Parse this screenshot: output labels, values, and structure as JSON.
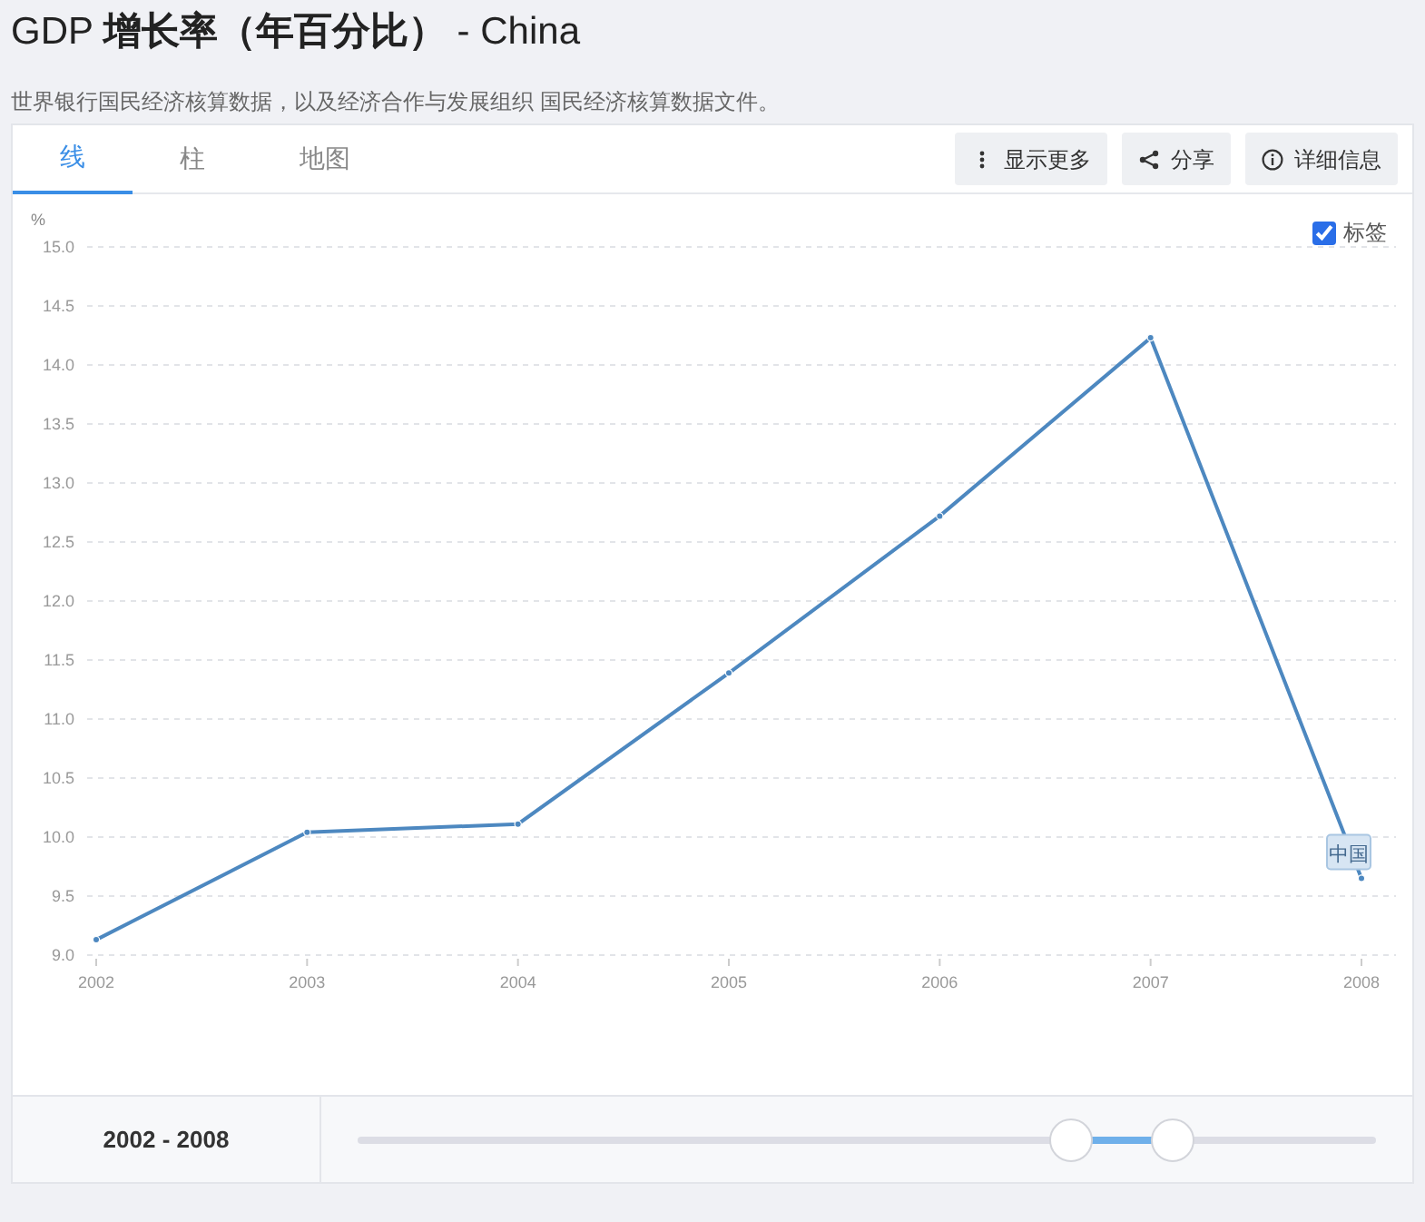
{
  "title": "GDP **增长率（年百分比）** - China",
  "subtitle": "世界银行国民经济核算数据，以及经济合作与发展组织 国民经济核算数据文件。",
  "tabs": [
    {
      "label": "线",
      "selected": true
    },
    {
      "label": "柱",
      "selected": false
    },
    {
      "label": "地图",
      "selected": false
    }
  ],
  "actions": [
    {
      "kind": "more",
      "label": "显示更多"
    },
    {
      "kind": "share",
      "label": "分享"
    },
    {
      "kind": "info",
      "label": "详细信息"
    }
  ],
  "labels_toggle": {
    "label": "标签",
    "checked": true
  },
  "chart_data": {
    "type": "line",
    "grid": true,
    "marker": true,
    "ylabel": "%",
    "categories": [
      "2002",
      "2003",
      "2004",
      "2005",
      "2006",
      "2007",
      "2008"
    ],
    "series": [
      {
        "name": "中国",
        "color": "#4d88c0",
        "values": [
          9.13,
          10.04,
          10.11,
          11.39,
          12.72,
          14.23,
          9.65
        ]
      }
    ],
    "ylim": [
      9.0,
      15.0
    ],
    "yticks": [
      {
        "value": 9.0,
        "label": "9.0"
      },
      {
        "value": 9.5,
        "label": "9.5"
      },
      {
        "value": 10.0,
        "label": "10.0"
      },
      {
        "value": 10.5,
        "label": "10.5"
      },
      {
        "value": 11.0,
        "label": "11.0"
      },
      {
        "value": 11.5,
        "label": "11.5"
      },
      {
        "value": 12.0,
        "label": "12.0"
      },
      {
        "value": 12.5,
        "label": "12.5"
      },
      {
        "value": 13.0,
        "label": "13.0"
      },
      {
        "value": 13.5,
        "label": "13.5"
      },
      {
        "value": 14.0,
        "label": "14.0"
      },
      {
        "value": 14.5,
        "label": "14.5"
      },
      {
        "value": 15.0,
        "label": "15.0"
      }
    ]
  },
  "range": {
    "label": "2002 - 2008",
    "thumbs": [
      {
        "level": 0.7
      },
      {
        "level": 0.8
      }
    ]
  }
}
